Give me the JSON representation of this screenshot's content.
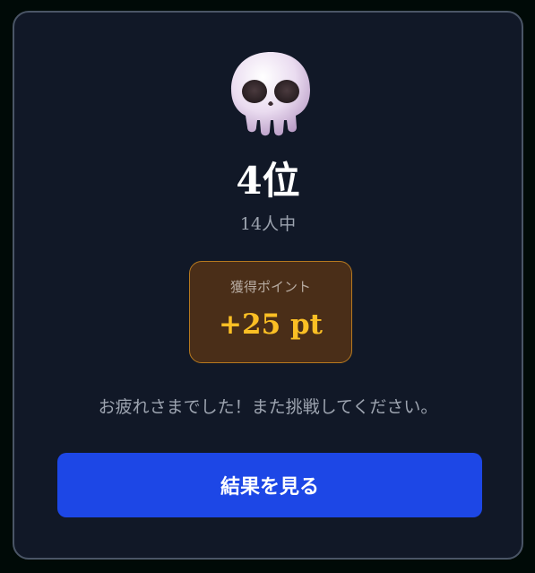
{
  "result": {
    "icon": "skull-icon",
    "rank": "4位",
    "participants": "14人中",
    "points_label": "獲得ポイント",
    "points_value": "+25 pt",
    "message": "お疲れさまでした！また挑戦してください。",
    "button_label": "結果を見る"
  },
  "colors": {
    "background": "#111827",
    "border": "#4a5566",
    "points_box_bg": "#4a2e18",
    "points_box_border": "#b7791f",
    "points_value": "#fbbf24",
    "button_bg": "#1d47e6",
    "muted_text": "#9ca3af"
  }
}
